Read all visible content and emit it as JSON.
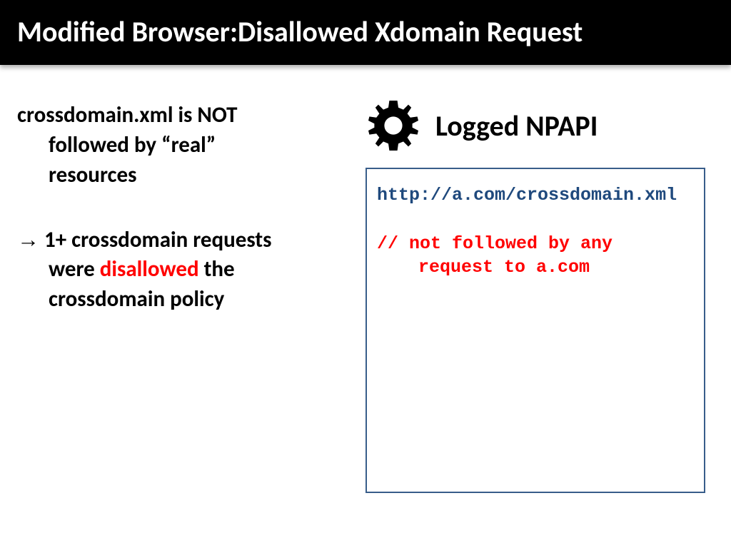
{
  "header": {
    "title": "Modified Browser:Disallowed Xdomain Request"
  },
  "left": {
    "p1_line1": "crossdomain.xml is NOT",
    "p1_line2": "followed by “real”",
    "p1_line3": "resources",
    "arrow": "→",
    "p2_line1_rest": " 1+ crossdomain requests",
    "p2_line2a": "were ",
    "p2_disallowed": "disallowed",
    "p2_line2b": " the",
    "p2_line3": "crossdomain policy"
  },
  "right": {
    "title": "Logged NPAPI",
    "code_url": "http://a.com/crossdomain.xml",
    "code_comment_l1": "// not followed by any",
    "code_comment_l2": "request to a.com"
  }
}
